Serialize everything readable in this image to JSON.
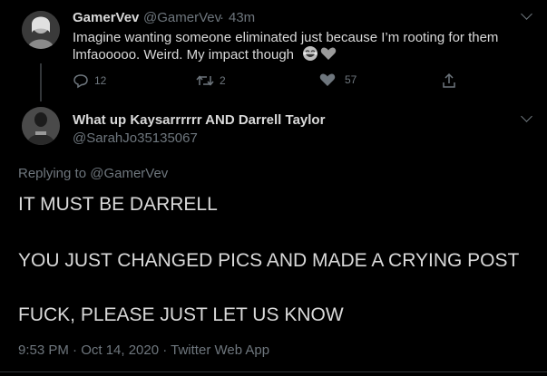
{
  "tweet1": {
    "display_name": "GamerVev",
    "handle": "@GamerVev",
    "separator": "·",
    "time": "43m",
    "text_line1": "Imagine wanting someone eliminated just because I’m rooting for them",
    "text_line2": "lmfaooooo. Weird. My impact though",
    "reply_count": "12",
    "retweet_count": "2",
    "like_count": "57"
  },
  "tweet2": {
    "display_name": "What up Kaysarrrrrr AND Darrell Taylor",
    "handle": "@SarahJo35135067",
    "replying_prefix": "Replying to",
    "replying_handle": "@GamerVev",
    "line1": "IT MUST BE DARRELL",
    "line2": "YOU JUST CHANGED PICS AND MADE A CRYING POST",
    "line3": "FUCK, PLEASE JUST LET US KNOW",
    "timestamp": "9:53 PM · Oct 14, 2020 · Twitter Web App"
  },
  "colors": {
    "background": "#000000",
    "text": "#d9d9d9",
    "muted": "#6e767d"
  },
  "icons": [
    "chevron-down-icon",
    "reply-icon",
    "retweet-icon",
    "like-icon",
    "share-icon",
    "laughing-emoji-icon",
    "heart-emoji-icon"
  ]
}
